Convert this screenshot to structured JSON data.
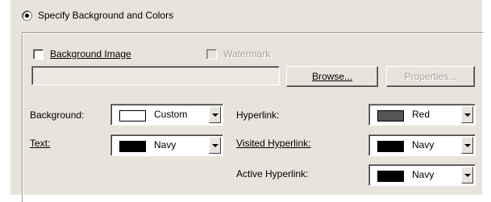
{
  "colors": {
    "face": "#e8e4dc",
    "navy": "#000000",
    "red": "#555555",
    "custom": "#ffffff"
  },
  "specify": {
    "label": "Specify Background and Colors"
  },
  "background_image": {
    "label": "Background Image",
    "checked": false
  },
  "watermark": {
    "label": "Watermark",
    "checked": false,
    "enabled": false
  },
  "path": {
    "value": ""
  },
  "buttons": {
    "browse": "Browse...",
    "properties": "Properties..."
  },
  "fields": {
    "background": {
      "label": "Background:",
      "value": "Custom",
      "swatch_icon": "white-swatch"
    },
    "text": {
      "label": "Text:",
      "value": "Navy",
      "swatch_icon": "black-swatch"
    },
    "hyperlink": {
      "label": "Hyperlink:",
      "value": "Red",
      "swatch_icon": "gray-swatch"
    },
    "visited": {
      "label": "Visited Hyperlink:",
      "value": "Navy",
      "swatch_icon": "black-swatch"
    },
    "active": {
      "label": "Active Hyperlink:",
      "value": "Navy",
      "swatch_icon": "black-swatch"
    }
  }
}
